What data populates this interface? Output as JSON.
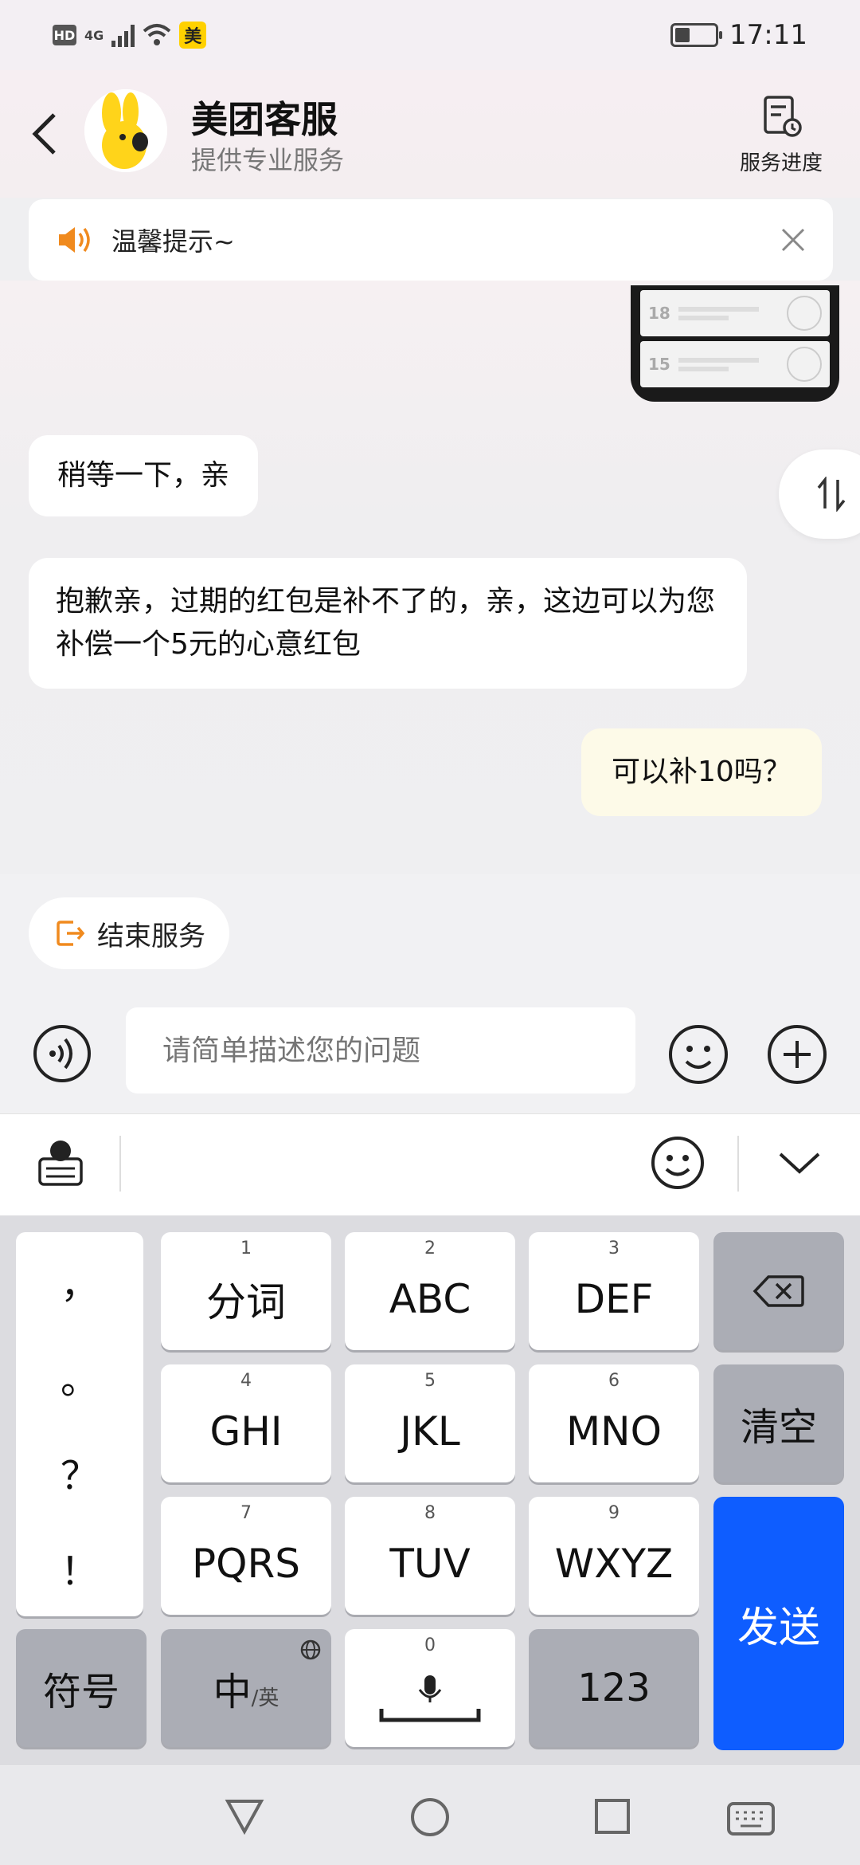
{
  "status_bar": {
    "hd": "HD",
    "signal": "4G",
    "app_badge": "美",
    "time": "17:11"
  },
  "header": {
    "title": "美团客服",
    "subtitle": "提供专业服务",
    "progress_label": "服务进度"
  },
  "tip": {
    "text": "温馨提示~"
  },
  "messages": [
    {
      "from": "agent",
      "text": "稍等一下，亲"
    },
    {
      "from": "agent",
      "text": "抱歉亲，过期的红包是补不了的，亲，这边可以为您补偿一个5元的心意红包"
    },
    {
      "from": "user",
      "text": "可以补10吗？"
    }
  ],
  "image_message": {
    "coupon_amounts": [
      "18",
      "15"
    ]
  },
  "actions": {
    "end_service": "结束服务"
  },
  "input": {
    "placeholder": "请简单描述您的问题"
  },
  "keyboard": {
    "punctuation": [
      "，",
      "。",
      "？",
      "！"
    ],
    "keys": [
      {
        "num": "1",
        "label": "分词"
      },
      {
        "num": "2",
        "label": "ABC"
      },
      {
        "num": "3",
        "label": "DEF"
      },
      {
        "num": "4",
        "label": "GHI"
      },
      {
        "num": "5",
        "label": "JKL"
      },
      {
        "num": "6",
        "label": "MNO"
      },
      {
        "num": "7",
        "label": "PQRS"
      },
      {
        "num": "8",
        "label": "TUV"
      },
      {
        "num": "9",
        "label": "WXYZ"
      }
    ],
    "clear": "清空",
    "symbols": "符号",
    "lang_main": "中",
    "lang_sub": "/英",
    "space_num": "0",
    "numbers": "123",
    "send": "发送"
  },
  "colors": {
    "accent": "#f08a1e",
    "send": "#0e5dff",
    "user_bubble": "#fdfae8"
  }
}
